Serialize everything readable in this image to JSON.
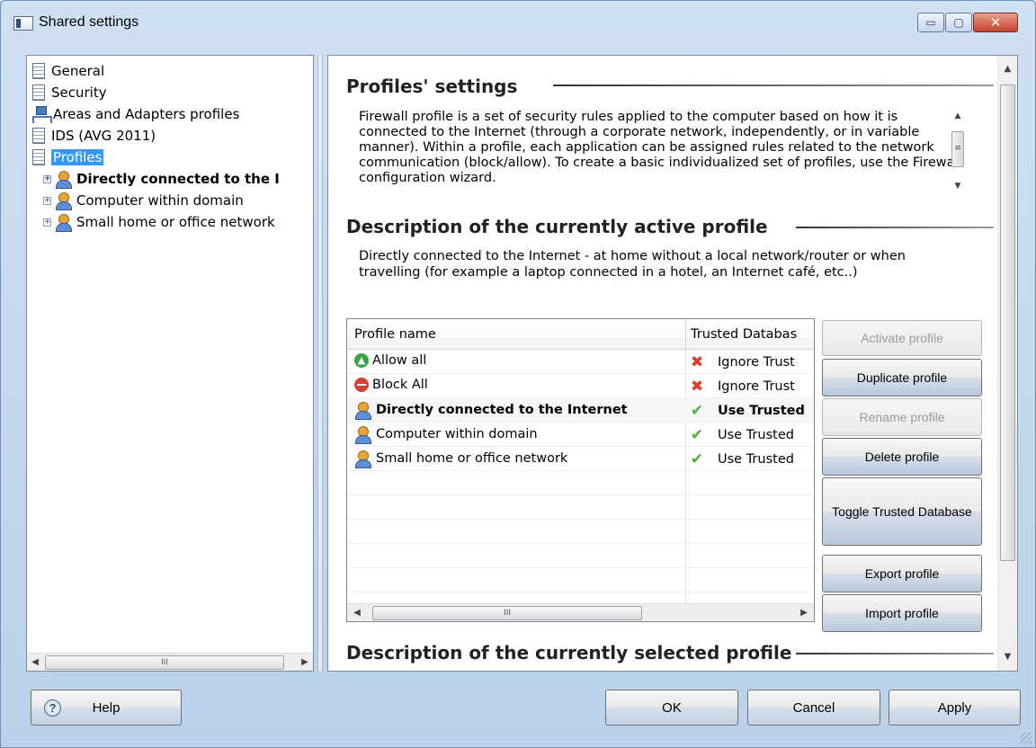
{
  "window": {
    "title": "Shared settings",
    "caption_min": "▭",
    "caption_max": "▢",
    "caption_close": "✕"
  },
  "tree": {
    "items": [
      {
        "label": "General",
        "icon": "document-icon"
      },
      {
        "label": "Security",
        "icon": "document-icon"
      },
      {
        "label": "Areas and Adapters profiles",
        "icon": "network-icon"
      },
      {
        "label": "IDS (AVG 2011)",
        "icon": "document-icon"
      },
      {
        "label": "Profiles",
        "icon": "document-icon",
        "selected": true
      },
      {
        "label": "Directly connected to the I",
        "icon": "person-icon",
        "bold": true
      },
      {
        "label": "Computer within domain",
        "icon": "person-icon"
      },
      {
        "label": "Small home or office network",
        "icon": "person-icon"
      }
    ],
    "expander": "+",
    "scroll_grip": "III"
  },
  "content": {
    "profiles_title": "Profiles' settings",
    "intro_text": "Firewall profile is a set of security rules applied to the computer based on how it is connected to the Internet (through a corporate network, independently, or in variable manner). Within a profile, each application can be assigned rules related to the network communication (block/allow). To create a basic individualized set of profiles, use the Firewall configuration wizard.",
    "active_title": "Description of the currently active profile",
    "active_desc": "Directly connected to the Internet - at home without a local network/router or when travelling (for example a laptop connected in a hotel, an Internet café, etc..)",
    "selected_title": "Description of the currently selected profile",
    "scroll_grip": "≡"
  },
  "table": {
    "columns": [
      "Profile name",
      "Trusted Databas"
    ],
    "rows": [
      {
        "name": "Allow all",
        "icon": "allow-icon",
        "db_icon": "x-icon",
        "db": "Ignore Trust"
      },
      {
        "name": "Block All",
        "icon": "block-icon",
        "db_icon": "x-icon",
        "db": "Ignore Trust"
      },
      {
        "name": "Directly connected to the Internet",
        "icon": "person-icon",
        "db_icon": "check-icon",
        "db": "Use Trusted",
        "bold": true
      },
      {
        "name": "Computer within domain",
        "icon": "person-icon",
        "db_icon": "check-icon",
        "db": "Use Trusted"
      },
      {
        "name": "Small home or office network",
        "icon": "person-icon",
        "db_icon": "check-icon",
        "db": "Use Trusted"
      }
    ],
    "scroll_grip": "III"
  },
  "buttons": {
    "activate": "Activate profile",
    "duplicate": "Duplicate profile",
    "rename": "Rename profile",
    "delete": "Delete profile",
    "toggle": "Toggle Trusted Database",
    "export": "Export profile",
    "import": "Import profile"
  },
  "footer": {
    "help": "Help",
    "help_icon": "?",
    "ok": "OK",
    "cancel": "Cancel",
    "apply": "Apply"
  },
  "glyphs": {
    "left": "◀",
    "right": "▶",
    "up": "▲",
    "down": "▼",
    "x": "✖",
    "check": "✔",
    "allow": "▲"
  }
}
